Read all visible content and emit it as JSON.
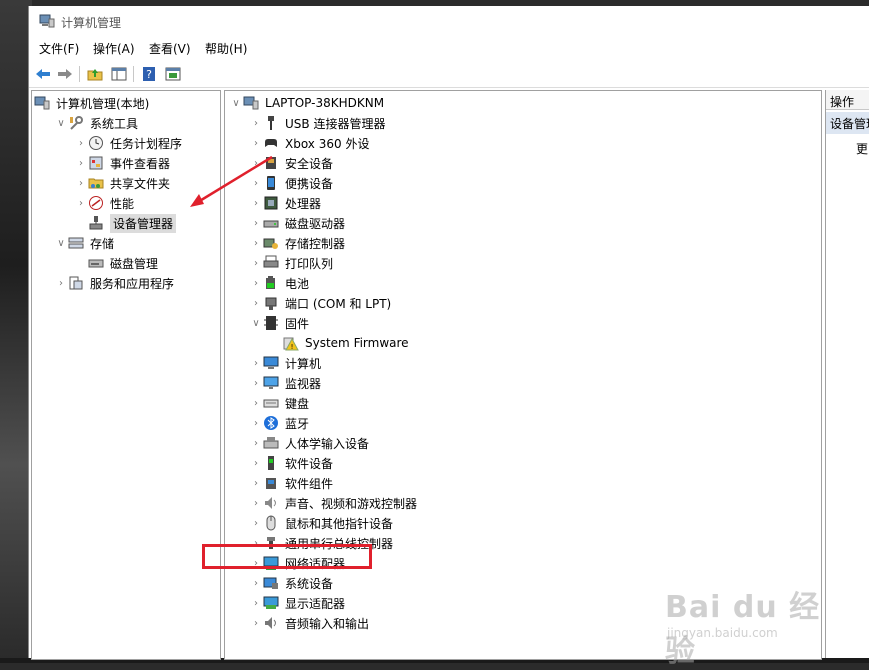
{
  "window": {
    "title": "计算机管理"
  },
  "menu": [
    "文件(F)",
    "操作(A)",
    "查看(V)",
    "帮助(H)"
  ],
  "left_tree": [
    {
      "label": "计算机管理(本地)",
      "icon": "computer-management-icon",
      "indent": 0,
      "chevron": ""
    },
    {
      "label": "系统工具",
      "icon": "system-tools-icon",
      "indent": 1,
      "chevron": "expanded"
    },
    {
      "label": "任务计划程序",
      "icon": "clock-icon",
      "indent": 2,
      "chevron": "collapsed"
    },
    {
      "label": "事件查看器",
      "icon": "event-viewer-icon",
      "indent": 2,
      "chevron": "collapsed"
    },
    {
      "label": "共享文件夹",
      "icon": "shared-folder-icon",
      "indent": 2,
      "chevron": "collapsed"
    },
    {
      "label": "性能",
      "icon": "performance-icon",
      "indent": 2,
      "chevron": "collapsed"
    },
    {
      "label": "设备管理器",
      "icon": "device-manager-icon",
      "indent": 2,
      "chevron": "",
      "selected": true
    },
    {
      "label": "存储",
      "icon": "storage-icon",
      "indent": 1,
      "chevron": "expanded"
    },
    {
      "label": "磁盘管理",
      "icon": "disk-management-icon",
      "indent": 2,
      "chevron": ""
    },
    {
      "label": "服务和应用程序",
      "icon": "services-icon",
      "indent": 1,
      "chevron": "collapsed"
    }
  ],
  "device_tree": {
    "root": "LAPTOP-38KHDKNM",
    "items": [
      {
        "label": "USB 连接器管理器",
        "icon": "usb-icon",
        "indent": 1,
        "chevron": "collapsed"
      },
      {
        "label": "Xbox 360 外设",
        "icon": "gamepad-icon",
        "indent": 1,
        "chevron": "collapsed"
      },
      {
        "label": "安全设备",
        "icon": "security-device-icon",
        "indent": 1,
        "chevron": "collapsed"
      },
      {
        "label": "便携设备",
        "icon": "portable-device-icon",
        "indent": 1,
        "chevron": "collapsed"
      },
      {
        "label": "处理器",
        "icon": "processor-icon",
        "indent": 1,
        "chevron": "collapsed"
      },
      {
        "label": "磁盘驱动器",
        "icon": "disk-drive-icon",
        "indent": 1,
        "chevron": "collapsed"
      },
      {
        "label": "存储控制器",
        "icon": "storage-controller-icon",
        "indent": 1,
        "chevron": "collapsed"
      },
      {
        "label": "打印队列",
        "icon": "printer-icon",
        "indent": 1,
        "chevron": "collapsed"
      },
      {
        "label": "电池",
        "icon": "battery-icon",
        "indent": 1,
        "chevron": "collapsed"
      },
      {
        "label": "端口 (COM 和 LPT)",
        "icon": "port-icon",
        "indent": 1,
        "chevron": "collapsed"
      },
      {
        "label": "固件",
        "icon": "firmware-icon",
        "indent": 1,
        "chevron": "expanded"
      },
      {
        "label": "System Firmware",
        "icon": "warning-icon",
        "indent": 2,
        "chevron": ""
      },
      {
        "label": "计算机",
        "icon": "computer-icon",
        "indent": 1,
        "chevron": "collapsed"
      },
      {
        "label": "监视器",
        "icon": "monitor-icon",
        "indent": 1,
        "chevron": "collapsed"
      },
      {
        "label": "键盘",
        "icon": "keyboard-icon",
        "indent": 1,
        "chevron": "collapsed"
      },
      {
        "label": "蓝牙",
        "icon": "bluetooth-icon",
        "indent": 1,
        "chevron": "collapsed"
      },
      {
        "label": "人体学输入设备",
        "icon": "hid-icon",
        "indent": 1,
        "chevron": "collapsed"
      },
      {
        "label": "软件设备",
        "icon": "software-device-icon",
        "indent": 1,
        "chevron": "collapsed"
      },
      {
        "label": "软件组件",
        "icon": "software-component-icon",
        "indent": 1,
        "chevron": "collapsed"
      },
      {
        "label": "声音、视频和游戏控制器",
        "icon": "sound-icon",
        "indent": 1,
        "chevron": "collapsed"
      },
      {
        "label": "鼠标和其他指针设备",
        "icon": "mouse-icon",
        "indent": 1,
        "chevron": "collapsed"
      },
      {
        "label": "通用串行总线控制器",
        "icon": "usb-controller-icon",
        "indent": 1,
        "chevron": "collapsed"
      },
      {
        "label": "网络适配器",
        "icon": "network-adapter-icon",
        "indent": 1,
        "chevron": "collapsed",
        "highlighted": true
      },
      {
        "label": "系统设备",
        "icon": "system-device-icon",
        "indent": 1,
        "chevron": "collapsed"
      },
      {
        "label": "显示适配器",
        "icon": "display-adapter-icon",
        "indent": 1,
        "chevron": "collapsed"
      },
      {
        "label": "音频输入和输出",
        "icon": "audio-io-icon",
        "indent": 1,
        "chevron": "collapsed"
      }
    ]
  },
  "actions": {
    "header": "操作",
    "subheader": "设备管理器",
    "more": "更多操作"
  },
  "watermark": {
    "brand": "Bai du 经验",
    "url": "jingyan.baidu.com"
  },
  "colors": {
    "highlight_border": "#e0202c",
    "arrow": "#e0202c",
    "selection": "#dcdcdc",
    "actions_sub": "#dde6f2"
  }
}
